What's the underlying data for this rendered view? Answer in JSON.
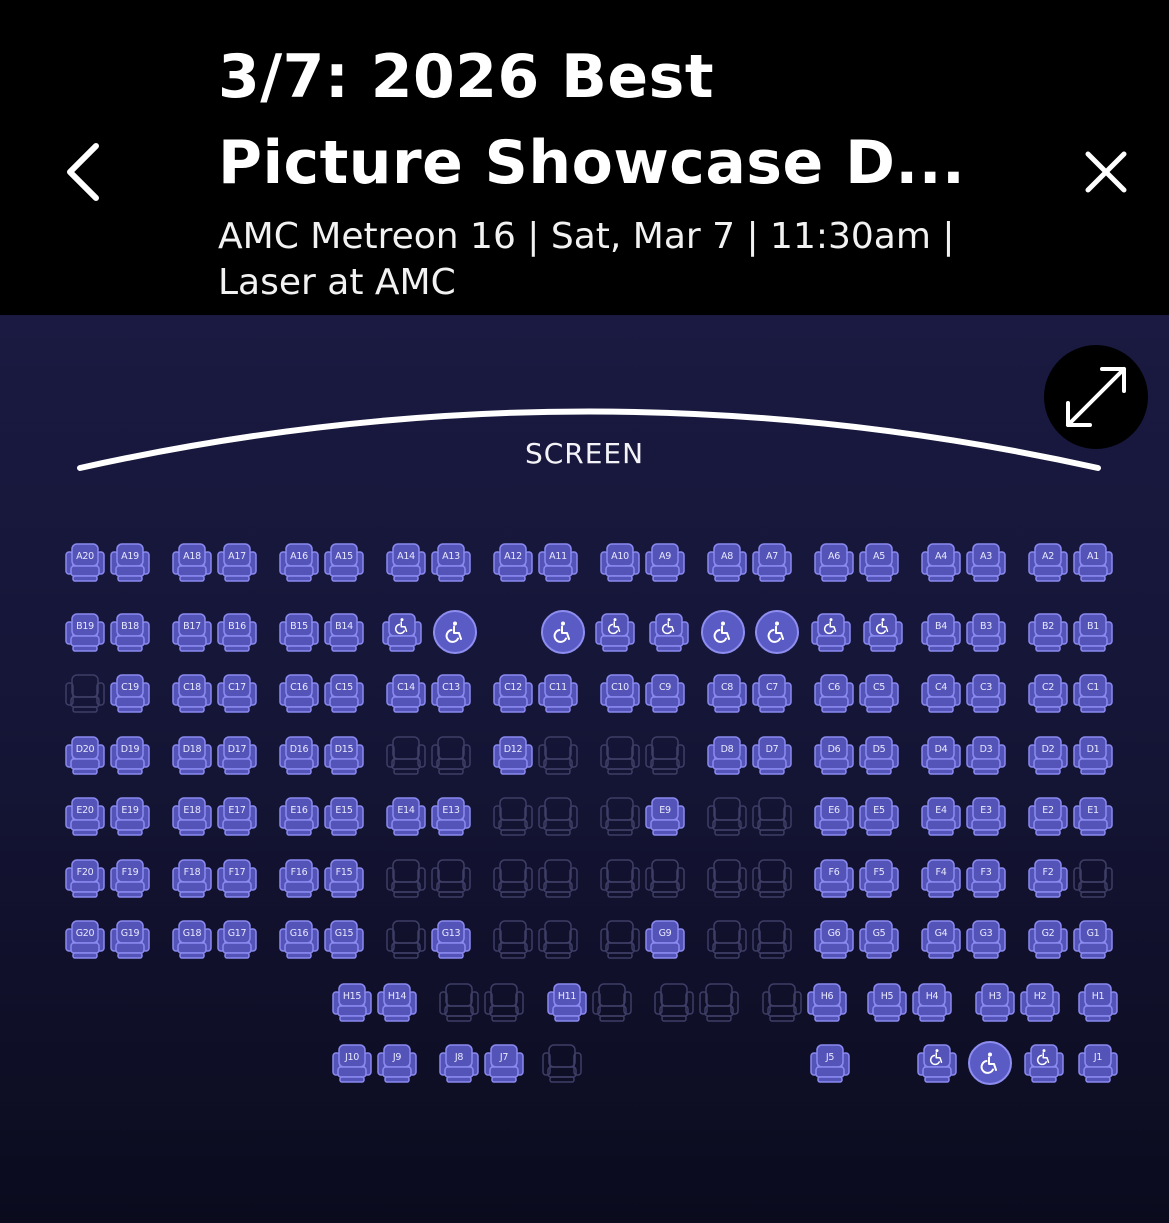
{
  "header": {
    "title_line1": "3/7: 2026 Best",
    "title_line2": "Picture Showcase D...",
    "subtitle_line1": "AMC Metreon 16 | Sat, Mar 7 | 11:30am |",
    "subtitle_line2": "Laser at AMC",
    "back_icon": "chevron-left-icon",
    "close_icon": "close-icon"
  },
  "map": {
    "screen_label": "SCREEN",
    "expand_icon": "expand-icon"
  },
  "colors": {
    "available_seat": "#5454b8",
    "seat_outline": "#8a8af0",
    "unavailable_outline": "#3e3e66",
    "background": "#151537"
  },
  "seat_rows": [
    {
      "row": "A",
      "seats": [
        {
          "label": "A20",
          "status": "available"
        },
        {
          "label": "A19",
          "status": "available"
        },
        {
          "label": "A18",
          "status": "available"
        },
        {
          "label": "A17",
          "status": "available"
        },
        {
          "label": "A16",
          "status": "available"
        },
        {
          "label": "A15",
          "status": "available"
        },
        {
          "label": "A14",
          "status": "available"
        },
        {
          "label": "A13",
          "status": "available"
        },
        {
          "label": "A12",
          "status": "available"
        },
        {
          "label": "A11",
          "status": "available"
        },
        {
          "label": "A10",
          "status": "available"
        },
        {
          "label": "A9",
          "status": "available"
        },
        {
          "label": "A8",
          "status": "available"
        },
        {
          "label": "A7",
          "status": "available"
        },
        {
          "label": "A6",
          "status": "available"
        },
        {
          "label": "A5",
          "status": "available"
        },
        {
          "label": "A4",
          "status": "available"
        },
        {
          "label": "A3",
          "status": "available"
        },
        {
          "label": "A2",
          "status": "available"
        },
        {
          "label": "A1",
          "status": "available"
        }
      ]
    },
    {
      "row": "B",
      "seats": [
        {
          "label": "B19",
          "status": "available"
        },
        {
          "label": "B18",
          "status": "available"
        },
        {
          "label": "B17",
          "status": "available"
        },
        {
          "label": "B16",
          "status": "available"
        },
        {
          "label": "B15",
          "status": "available"
        },
        {
          "label": "B14",
          "status": "available"
        },
        {
          "label": "",
          "status": "companion"
        },
        {
          "label": "",
          "status": "wheelchair"
        },
        {
          "label": "",
          "status": "wheelchair"
        },
        {
          "label": "",
          "status": "companion"
        },
        {
          "label": "",
          "status": "companion"
        },
        {
          "label": "",
          "status": "wheelchair"
        },
        {
          "label": "",
          "status": "wheelchair"
        },
        {
          "label": "",
          "status": "companion"
        },
        {
          "label": "",
          "status": "companion"
        },
        {
          "label": "B4",
          "status": "available"
        },
        {
          "label": "B3",
          "status": "available"
        },
        {
          "label": "B2",
          "status": "available"
        },
        {
          "label": "B1",
          "status": "available"
        }
      ]
    },
    {
      "row": "C",
      "seats": [
        {
          "label": "",
          "status": "unavailable"
        },
        {
          "label": "C19",
          "status": "available"
        },
        {
          "label": "C18",
          "status": "available"
        },
        {
          "label": "C17",
          "status": "available"
        },
        {
          "label": "C16",
          "status": "available"
        },
        {
          "label": "C15",
          "status": "available"
        },
        {
          "label": "C14",
          "status": "available"
        },
        {
          "label": "C13",
          "status": "available"
        },
        {
          "label": "C12",
          "status": "available"
        },
        {
          "label": "C11",
          "status": "available"
        },
        {
          "label": "C10",
          "status": "available"
        },
        {
          "label": "C9",
          "status": "available"
        },
        {
          "label": "C8",
          "status": "available"
        },
        {
          "label": "C7",
          "status": "available"
        },
        {
          "label": "C6",
          "status": "available"
        },
        {
          "label": "C5",
          "status": "available"
        },
        {
          "label": "C4",
          "status": "available"
        },
        {
          "label": "C3",
          "status": "available"
        },
        {
          "label": "C2",
          "status": "available"
        },
        {
          "label": "C1",
          "status": "available"
        }
      ]
    },
    {
      "row": "D",
      "seats": [
        {
          "label": "D20",
          "status": "available"
        },
        {
          "label": "D19",
          "status": "available"
        },
        {
          "label": "D18",
          "status": "available"
        },
        {
          "label": "D17",
          "status": "available"
        },
        {
          "label": "D16",
          "status": "available"
        },
        {
          "label": "D15",
          "status": "available"
        },
        {
          "label": "",
          "status": "unavailable"
        },
        {
          "label": "",
          "status": "unavailable"
        },
        {
          "label": "D12",
          "status": "available"
        },
        {
          "label": "",
          "status": "unavailable"
        },
        {
          "label": "",
          "status": "unavailable"
        },
        {
          "label": "",
          "status": "unavailable"
        },
        {
          "label": "D8",
          "status": "available"
        },
        {
          "label": "D7",
          "status": "available"
        },
        {
          "label": "D6",
          "status": "available"
        },
        {
          "label": "D5",
          "status": "available"
        },
        {
          "label": "D4",
          "status": "available"
        },
        {
          "label": "D3",
          "status": "available"
        },
        {
          "label": "D2",
          "status": "available"
        },
        {
          "label": "D1",
          "status": "available"
        }
      ]
    },
    {
      "row": "E",
      "seats": [
        {
          "label": "E20",
          "status": "available"
        },
        {
          "label": "E19",
          "status": "available"
        },
        {
          "label": "E18",
          "status": "available"
        },
        {
          "label": "E17",
          "status": "available"
        },
        {
          "label": "E16",
          "status": "available"
        },
        {
          "label": "E15",
          "status": "available"
        },
        {
          "label": "E14",
          "status": "available"
        },
        {
          "label": "E13",
          "status": "available"
        },
        {
          "label": "",
          "status": "unavailable"
        },
        {
          "label": "",
          "status": "unavailable"
        },
        {
          "label": "",
          "status": "unavailable"
        },
        {
          "label": "E9",
          "status": "available"
        },
        {
          "label": "",
          "status": "unavailable"
        },
        {
          "label": "",
          "status": "unavailable"
        },
        {
          "label": "E6",
          "status": "available"
        },
        {
          "label": "E5",
          "status": "available"
        },
        {
          "label": "E4",
          "status": "available"
        },
        {
          "label": "E3",
          "status": "available"
        },
        {
          "label": "E2",
          "status": "available"
        },
        {
          "label": "E1",
          "status": "available"
        }
      ]
    },
    {
      "row": "F",
      "seats": [
        {
          "label": "F20",
          "status": "available"
        },
        {
          "label": "F19",
          "status": "available"
        },
        {
          "label": "F18",
          "status": "available"
        },
        {
          "label": "F17",
          "status": "available"
        },
        {
          "label": "F16",
          "status": "available"
        },
        {
          "label": "F15",
          "status": "available"
        },
        {
          "label": "",
          "status": "unavailable"
        },
        {
          "label": "",
          "status": "unavailable"
        },
        {
          "label": "",
          "status": "unavailable"
        },
        {
          "label": "",
          "status": "unavailable"
        },
        {
          "label": "",
          "status": "unavailable"
        },
        {
          "label": "",
          "status": "unavailable"
        },
        {
          "label": "",
          "status": "unavailable"
        },
        {
          "label": "",
          "status": "unavailable"
        },
        {
          "label": "F6",
          "status": "available"
        },
        {
          "label": "F5",
          "status": "available"
        },
        {
          "label": "F4",
          "status": "available"
        },
        {
          "label": "F3",
          "status": "available"
        },
        {
          "label": "F2",
          "status": "available"
        },
        {
          "label": "",
          "status": "unavailable"
        }
      ]
    },
    {
      "row": "G",
      "seats": [
        {
          "label": "G20",
          "status": "available"
        },
        {
          "label": "G19",
          "status": "available"
        },
        {
          "label": "G18",
          "status": "available"
        },
        {
          "label": "G17",
          "status": "available"
        },
        {
          "label": "G16",
          "status": "available"
        },
        {
          "label": "G15",
          "status": "available"
        },
        {
          "label": "",
          "status": "unavailable"
        },
        {
          "label": "G13",
          "status": "available"
        },
        {
          "label": "",
          "status": "unavailable"
        },
        {
          "label": "",
          "status": "unavailable"
        },
        {
          "label": "",
          "status": "unavailable"
        },
        {
          "label": "G9",
          "status": "available"
        },
        {
          "label": "",
          "status": "unavailable"
        },
        {
          "label": "",
          "status": "unavailable"
        },
        {
          "label": "G6",
          "status": "available"
        },
        {
          "label": "G5",
          "status": "available"
        },
        {
          "label": "G4",
          "status": "available"
        },
        {
          "label": "G3",
          "status": "available"
        },
        {
          "label": "G2",
          "status": "available"
        },
        {
          "label": "G1",
          "status": "available"
        }
      ]
    },
    {
      "row": "H",
      "seats": [
        {
          "label": "H15",
          "status": "available"
        },
        {
          "label": "H14",
          "status": "available"
        },
        {
          "label": "",
          "status": "unavailable"
        },
        {
          "label": "",
          "status": "unavailable"
        },
        {
          "label": "H11",
          "status": "available"
        },
        {
          "label": "",
          "status": "unavailable"
        },
        {
          "label": "",
          "status": "unavailable"
        },
        {
          "label": "",
          "status": "unavailable"
        },
        {
          "label": "",
          "status": "unavailable"
        },
        {
          "label": "H6",
          "status": "available"
        },
        {
          "label": "H5",
          "status": "available"
        },
        {
          "label": "H4",
          "status": "available"
        },
        {
          "label": "H3",
          "status": "available"
        },
        {
          "label": "H2",
          "status": "available"
        },
        {
          "label": "H1",
          "status": "available"
        }
      ]
    },
    {
      "row": "J",
      "seats": [
        {
          "label": "J10",
          "status": "available"
        },
        {
          "label": "J9",
          "status": "available"
        },
        {
          "label": "J8",
          "status": "available"
        },
        {
          "label": "J7",
          "status": "available"
        },
        {
          "label": "",
          "status": "unavailable"
        },
        {
          "label": "J5",
          "status": "available"
        },
        {
          "label": "",
          "status": "companion"
        },
        {
          "label": "",
          "status": "wheelchair"
        },
        {
          "label": "",
          "status": "companion"
        },
        {
          "label": "J1",
          "status": "available"
        }
      ]
    }
  ]
}
